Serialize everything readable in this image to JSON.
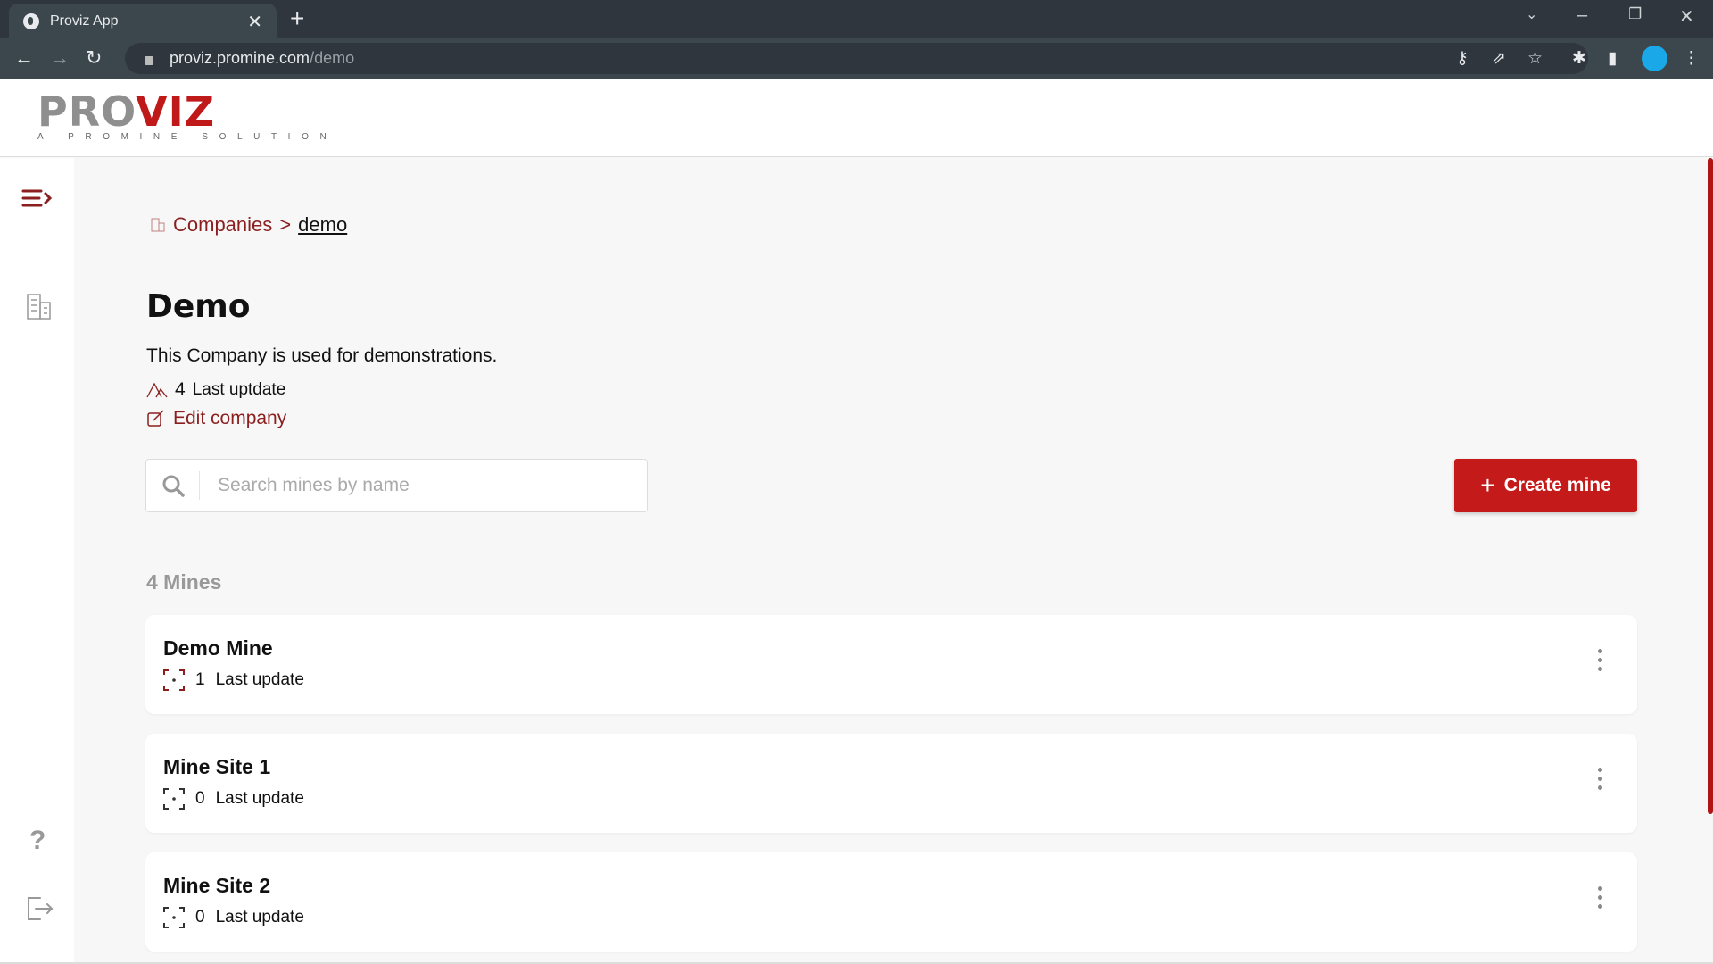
{
  "browser": {
    "tab_title": "Proviz App",
    "url_host": "proviz.promine.com",
    "url_path": "/demo"
  },
  "logo": {
    "text_gray": "PRO",
    "text_red": "VIZ",
    "tagline": "A PROMINE SOLUTION"
  },
  "breadcrumb": {
    "parent": "Companies",
    "separator": ">",
    "current": "demo"
  },
  "company": {
    "title": "Demo",
    "description": "This Company is used for demonstrations.",
    "mine_count": "4",
    "last_update_label": "Last uptdate",
    "edit_label": "Edit company"
  },
  "search": {
    "placeholder": "Search mines by name"
  },
  "create_button": "Create mine",
  "mines_heading": "4 Mines",
  "mines": [
    {
      "name": "Demo Mine",
      "count": "1",
      "last_update_label": "Last update"
    },
    {
      "name": "Mine Site 1",
      "count": "0",
      "last_update_label": "Last update"
    },
    {
      "name": "Mine Site 2",
      "count": "0",
      "last_update_label": "Last update"
    }
  ],
  "colors": {
    "accent": "#c41a1a",
    "link": "#8b1f1f",
    "background": "#f7f7f7"
  }
}
